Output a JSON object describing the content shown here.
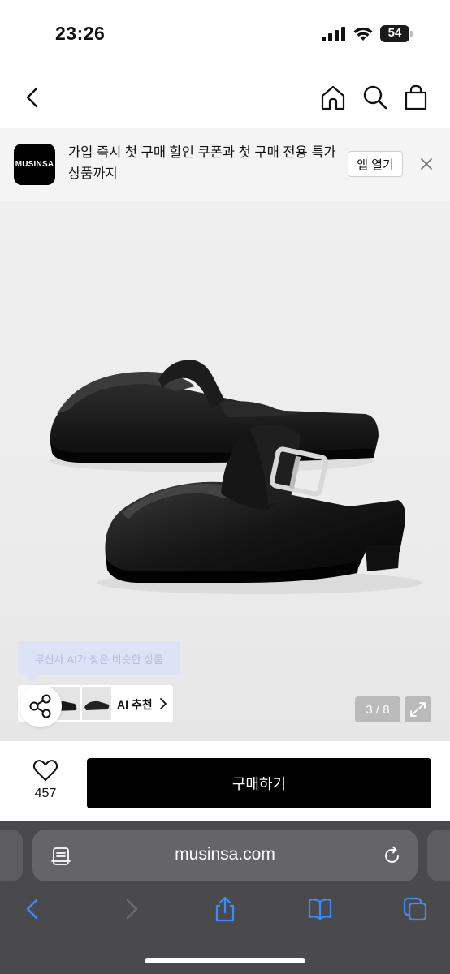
{
  "status_bar": {
    "time": "23:26",
    "battery": "54"
  },
  "nav": {
    "icons": [
      "back-arrow-icon",
      "home-icon",
      "search-icon",
      "shopping-bag-icon"
    ]
  },
  "app_banner": {
    "logo_text": "MUSINSA",
    "message": "가입 즉시 첫 구매 할인 쿠폰과 첫 구매 전용 특가 상품까지",
    "open_label": "앱 열기"
  },
  "gallery": {
    "ai_tooltip": "무신사 AI가 찾은 비슷한 상품",
    "ai_label": "AI 추천",
    "counter": "3 / 8"
  },
  "purchase": {
    "like_count": "457",
    "buy_label": "구매하기"
  },
  "browser": {
    "url": "musinsa.com",
    "toolbar_icons": [
      "back-icon",
      "forward-icon",
      "share-icon",
      "bookmarks-icon",
      "tabs-icon"
    ]
  },
  "colors": {
    "accent": "#000000",
    "safari_blue": "#3a8cff",
    "ai_tooltip_bg": "#dde3f5"
  }
}
